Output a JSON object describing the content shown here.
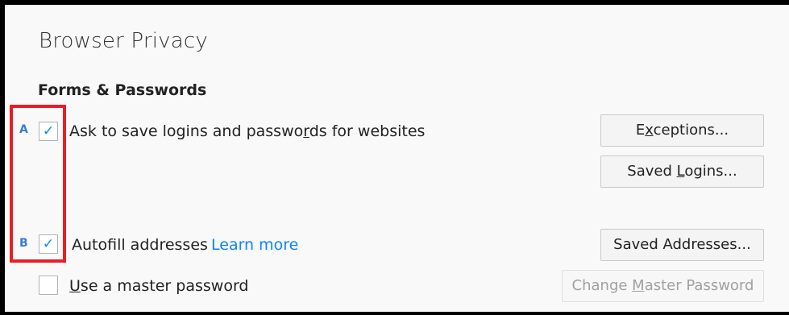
{
  "page": {
    "title": "Browser Privacy"
  },
  "forms_passwords": {
    "heading": "Forms & Passwords",
    "annotations": {
      "a": "A",
      "b": "B"
    },
    "ask_save_logins": {
      "label_pre": "Ask to save logins and passwo",
      "label_accel": "r",
      "label_post": "ds for websites",
      "checked": true
    },
    "exceptions_button": {
      "pre": "E",
      "accel": "x",
      "post": "ceptions..."
    },
    "saved_logins_button": {
      "pre": "Saved ",
      "accel": "L",
      "post": "ogins..."
    },
    "autofill_addresses": {
      "label": "Autofill addresses",
      "link": "Learn more",
      "checked": true
    },
    "saved_addresses_button": {
      "label": "Saved Addresses..."
    },
    "master_password": {
      "label_accel": "U",
      "label_post": "se a master password",
      "checked": false
    },
    "change_master_button": {
      "pre": "Change ",
      "accel": "M",
      "post": "aster Password"
    }
  },
  "colors": {
    "accent": "#0a84ff",
    "annotation_box": "#ec1c24",
    "annotation_letter": "#3a7bd5"
  }
}
